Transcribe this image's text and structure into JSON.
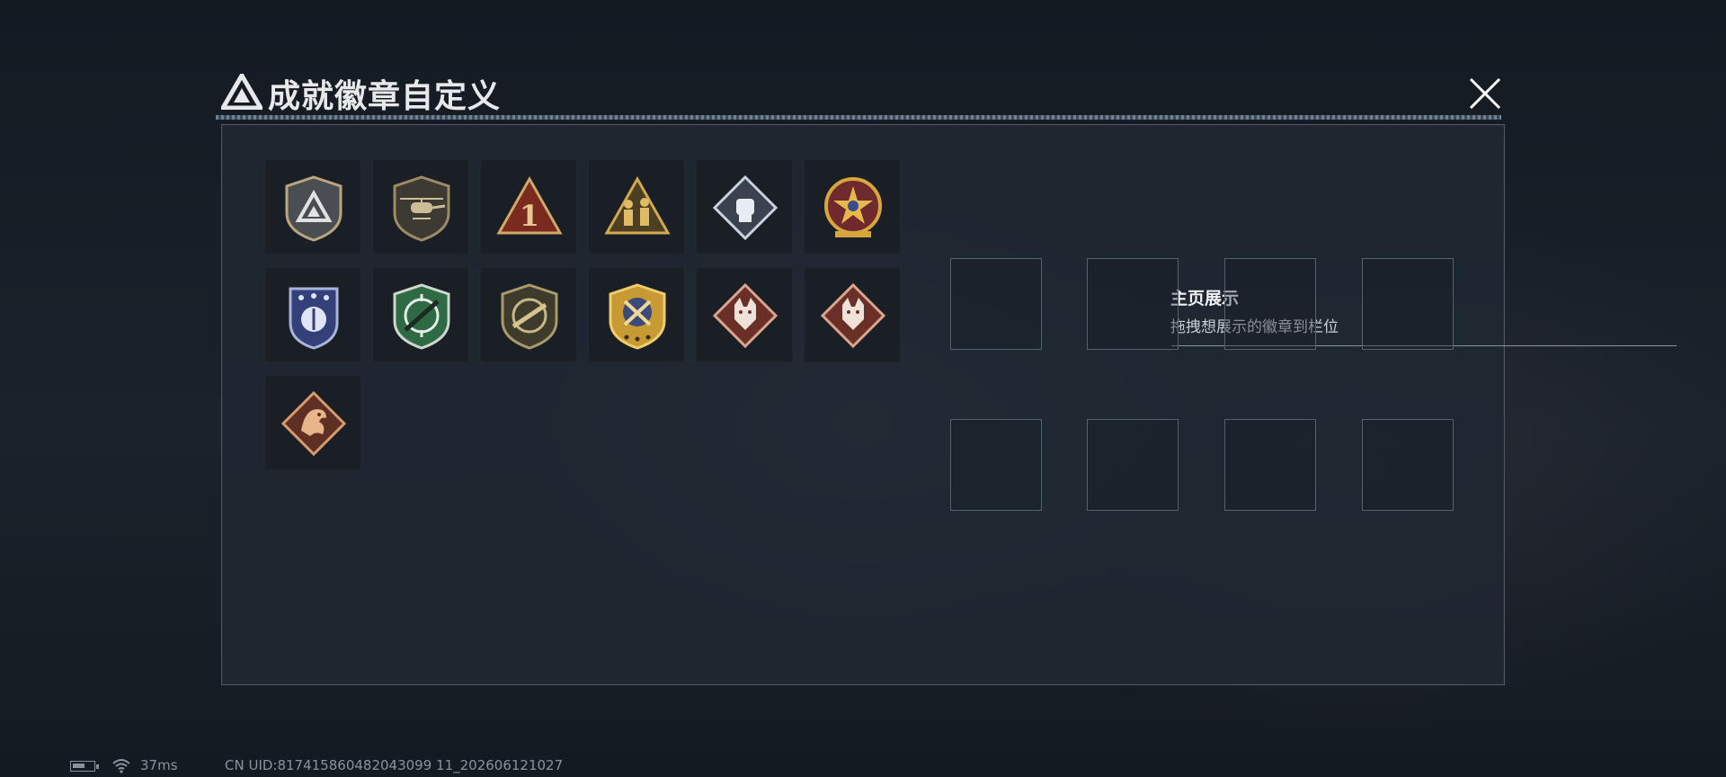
{
  "title": "成就徽章自定义",
  "icons": {
    "title_logo": "triangle-logo-icon",
    "close": "close-icon",
    "battery": "battery-icon",
    "wifi": "wifi-icon"
  },
  "badges": [
    {
      "icon": "triangle-shield-badge-icon"
    },
    {
      "icon": "helicopter-shield-badge-icon"
    },
    {
      "icon": "number-one-triangle-badge-icon"
    },
    {
      "icon": "soldiers-triangle-badge-icon"
    },
    {
      "icon": "fist-diamond-badge-icon"
    },
    {
      "icon": "star-emblem-badge-icon"
    },
    {
      "icon": "blue-crest-badge-icon"
    },
    {
      "icon": "green-crosshair-rifle-badge-icon"
    },
    {
      "icon": "bronze-rifle-badge-icon"
    },
    {
      "icon": "gold-crossed-crest-badge-icon"
    },
    {
      "icon": "wolf-diamond-badge-icon"
    },
    {
      "icon": "wolf-diamond-badge-icon"
    },
    {
      "icon": "dragon-diamond-badge-icon"
    }
  ],
  "showcase": {
    "title": "主页展示",
    "subtitle": "拖拽想展示的徽章到栏位",
    "slot_count": 8
  },
  "status": {
    "battery_level": 0.6,
    "ping": "37ms",
    "uid": "CN UID:817415860482043099 11_202606121027"
  },
  "colors": {
    "background": "#161c24",
    "panel": "#202832",
    "slot_border": "#56616c",
    "divider": "#8a949e"
  }
}
